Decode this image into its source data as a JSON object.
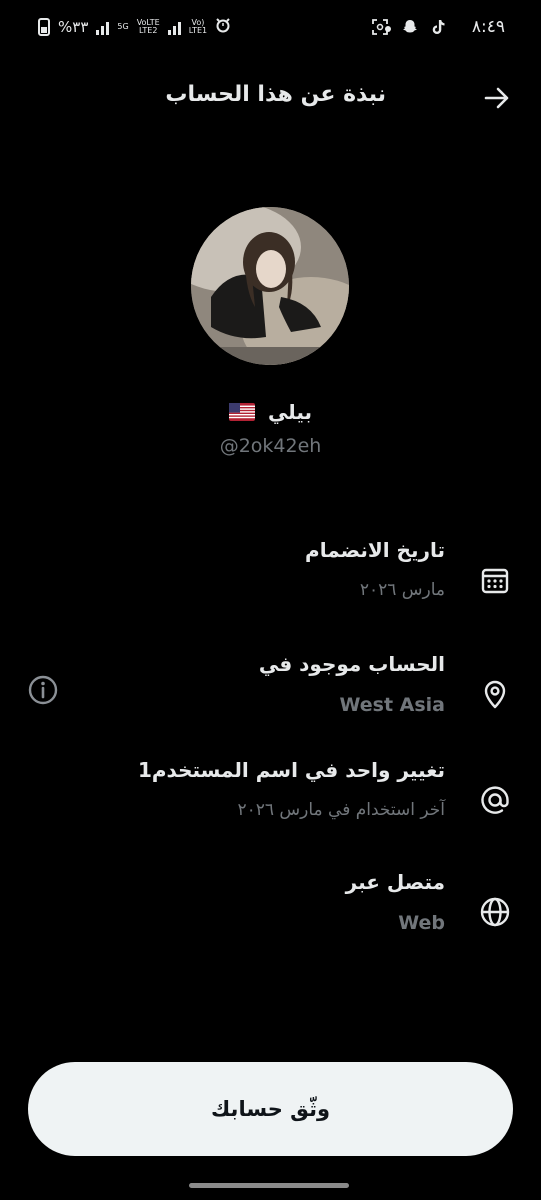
{
  "status_bar": {
    "time": "٨:٤٩",
    "battery_text": "%٣٣",
    "net1": "5G",
    "net2_line1": "VoLTE",
    "net2_line2": "LTE2",
    "net3_line1": "Vo)",
    "net3_line2": "LTE1"
  },
  "header": {
    "title": "نبذة عن هذا الحساب",
    "back_icon": "arrow-right-icon"
  },
  "profile": {
    "display_name": "بيلي",
    "flag": "us-flag",
    "handle": "@2ok42eh"
  },
  "rows": [
    {
      "icon": "calendar-icon",
      "title": "تاريخ الانضمام",
      "subtitle": "مارس ٢٠٢٦"
    },
    {
      "icon": "location-pin-icon",
      "title": "الحساب موجود في",
      "subtitle": "West Asia"
    },
    {
      "icon": "at-sign-icon",
      "title": "تغيير واحد في اسم المستخدم1",
      "subtitle": "آخر استخدام في مارس ٢٠٢٦"
    },
    {
      "icon": "globe-icon",
      "title": "متصل عبر",
      "subtitle": "Web"
    }
  ],
  "verify_button": {
    "label": "وثّق حسابك"
  },
  "colors": {
    "background": "#000000",
    "primary_text": "#e7e9ea",
    "secondary_text": "#71767b",
    "button_bg": "#eff3f4",
    "button_text": "#0f1419"
  }
}
